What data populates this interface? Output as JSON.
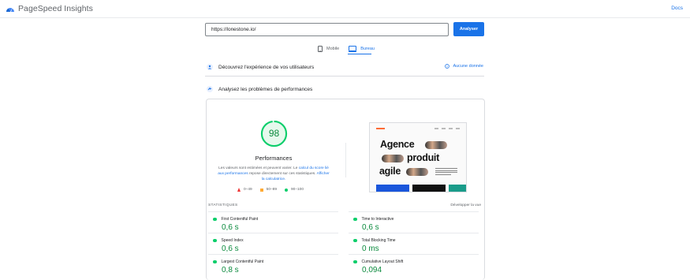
{
  "header": {
    "brand": "PageSpeed Insights",
    "logo_icon": "pagespeed-logo-icon",
    "docs_label": "Docs"
  },
  "url_bar": {
    "value": "https://lonestone.io/",
    "analyze_label": "Analyser"
  },
  "device_tabs": [
    {
      "label": "Mobile",
      "icon": "mobile-icon",
      "active": false
    },
    {
      "label": "Bureau",
      "icon": "desktop-icon",
      "active": true
    }
  ],
  "sections": {
    "user_experience": {
      "title": "Découvrez l'expérience de vos utilisateurs",
      "status": "Aucune donnée",
      "icon": "users-icon"
    },
    "performance_issues": {
      "title": "Analysez les problèmes de performances",
      "icon": "performance-icon"
    }
  },
  "performance": {
    "score": "98",
    "label": "Performances",
    "disclaimer_prefix": "Les valeurs sont estimées et peuvent varier. Le ",
    "disclaimer_link1": "calcul du score lié aux performances",
    "disclaimer_mid": " repose directement sur ces statistiques. ",
    "disclaimer_link2": "Afficher la calculatrice.",
    "legend": [
      {
        "label": "0–49",
        "shape": "triangle",
        "color": "#ff3333"
      },
      {
        "label": "50–89",
        "shape": "square",
        "color": "#ffaa33"
      },
      {
        "label": "90–100",
        "shape": "circle",
        "color": "#0cce6b"
      }
    ],
    "colors": {
      "good": "#0cce6b",
      "good_text": "#0c8a3e",
      "accent": "#1a73e8"
    }
  },
  "thumbnail": {
    "words": [
      "Agence",
      "produit",
      "agile"
    ]
  },
  "statistics": {
    "title": "STATISTIQUES",
    "expand_label": "Développer la vue",
    "metrics": [
      {
        "name": "First Contentful Paint",
        "value": "0,6 s"
      },
      {
        "name": "Time to Interactive",
        "value": "0,6 s"
      },
      {
        "name": "Speed Index",
        "value": "0,6 s"
      },
      {
        "name": "Total Blocking Time",
        "value": "0 ms"
      },
      {
        "name": "Largest Contentful Paint",
        "value": "0,8 s"
      },
      {
        "name": "Cumulative Layout Shift",
        "value": "0,094"
      }
    ]
  }
}
